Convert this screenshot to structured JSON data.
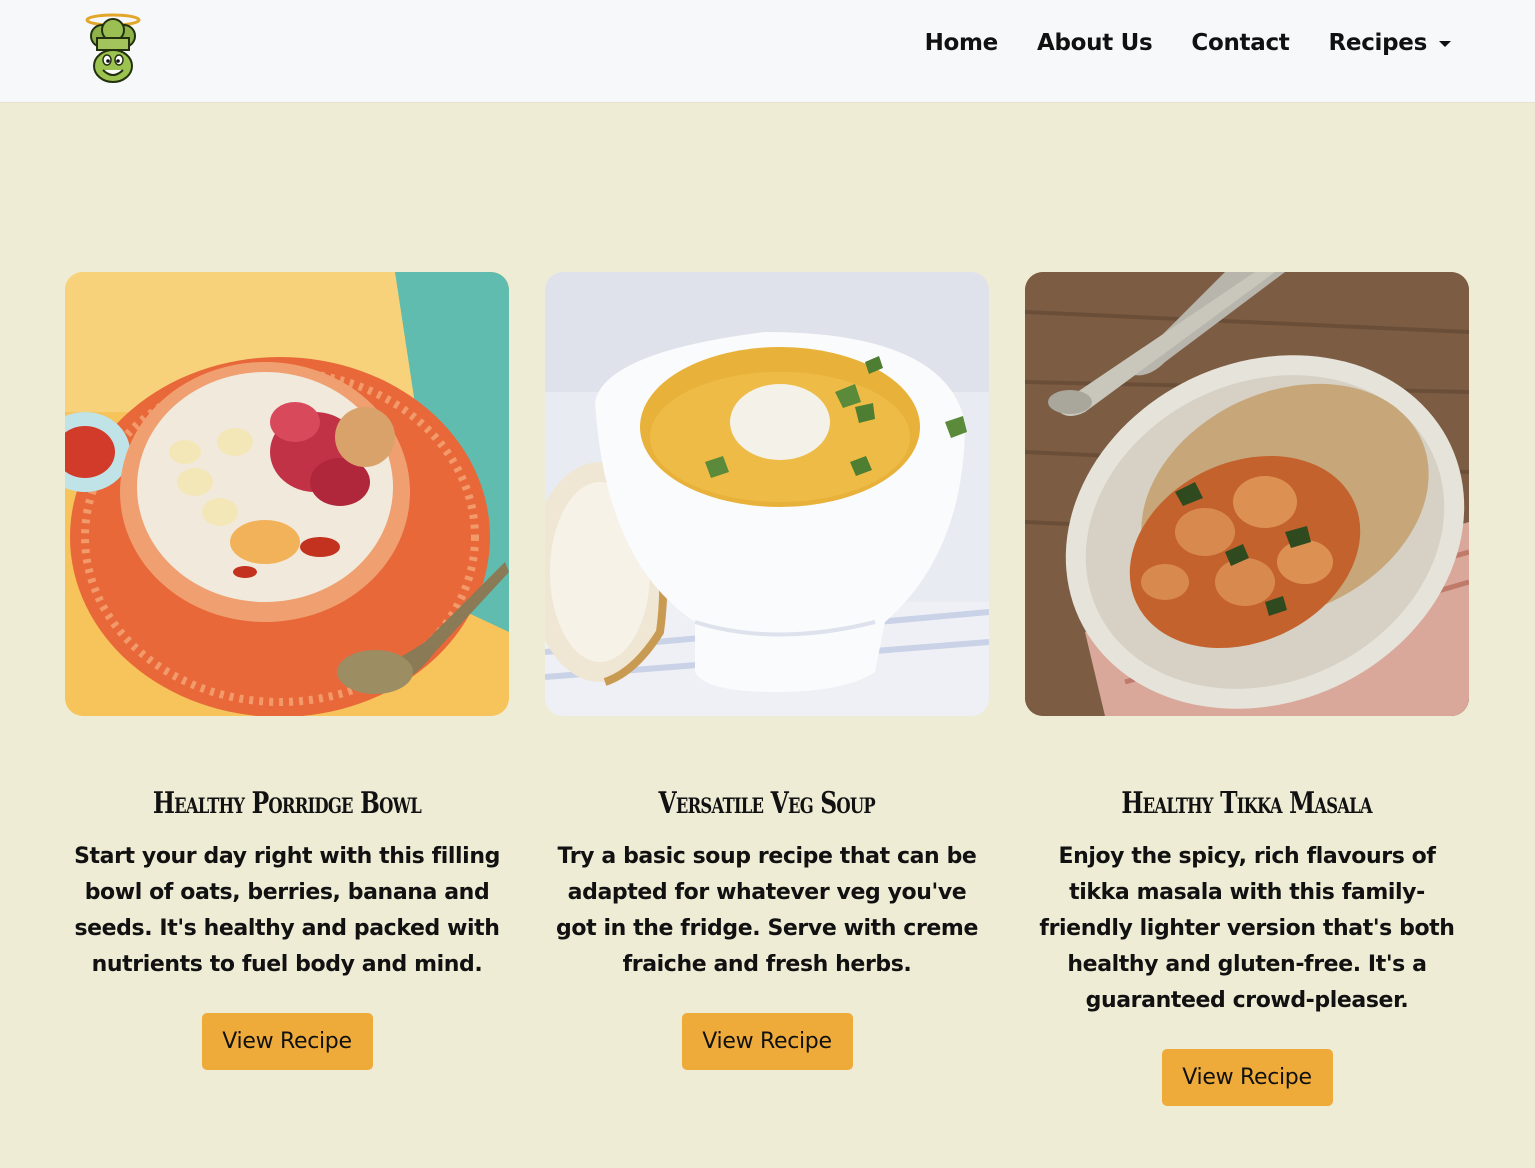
{
  "nav": {
    "logo": "chef-logo",
    "links": [
      "Home",
      "About Us",
      "Contact"
    ],
    "dropdown_label": "Recipes"
  },
  "colors": {
    "background": "#efecd6",
    "navbar": "#f7f8fa",
    "button": "#efab3a"
  },
  "cards": [
    {
      "image": "porridge-bowl-photo",
      "title": "Healthy Porridge Bowl",
      "description": "Start your day right with this filling bowl of oats, berries, banana and seeds. It's healthy and packed with nutrients to fuel body and mind.",
      "button": "View Recipe"
    },
    {
      "image": "veg-soup-photo",
      "title": "Versatile Veg Soup",
      "description": "Try a basic soup recipe that can be adapted for whatever veg you've got in the fridge. Serve with creme fraiche and fresh herbs.",
      "button": "View Recipe"
    },
    {
      "image": "tikka-masala-photo",
      "title": "Healthy Tikka Masala",
      "description": "Enjoy the spicy, rich flavours of tikka masala with this family-friendly lighter version that's both healthy and gluten-free. It's a guaranteed crowd-pleaser.",
      "button": "View Recipe"
    }
  ]
}
